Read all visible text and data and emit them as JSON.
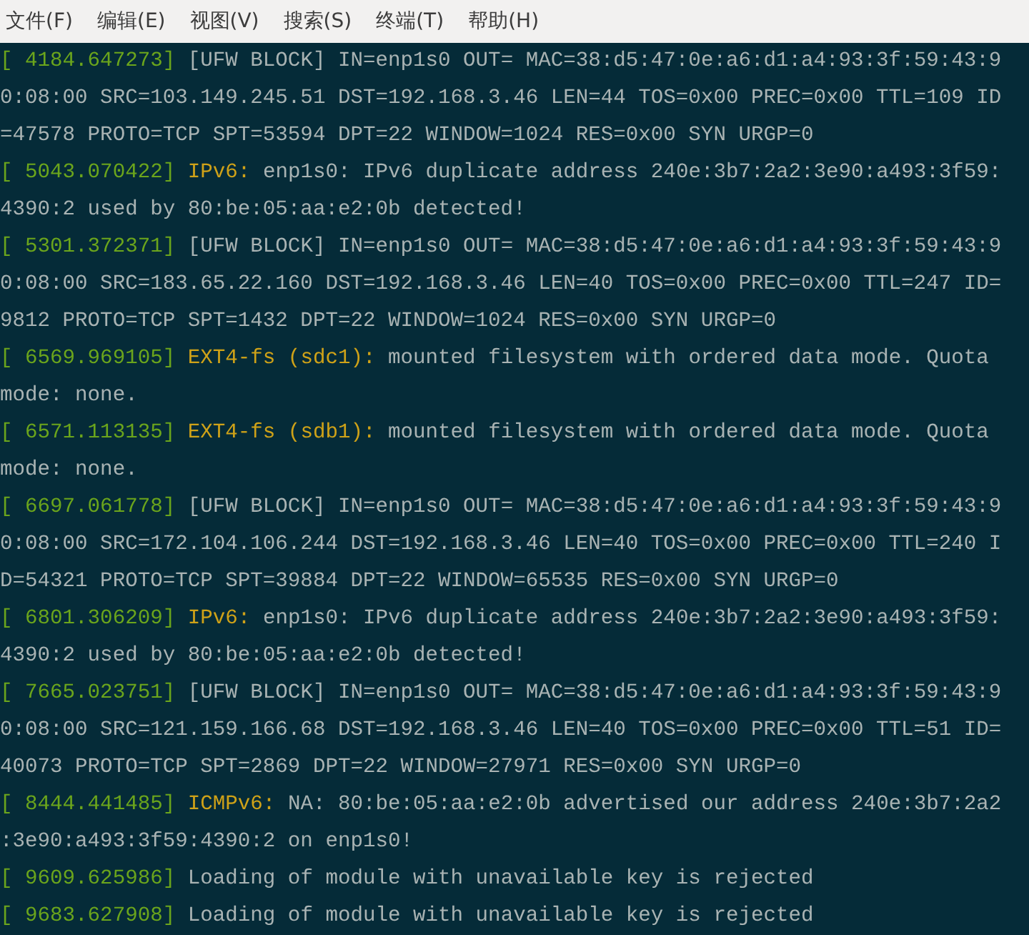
{
  "menu": [
    "文件(F)",
    "编辑(E)",
    "视图(V)",
    "搜索(S)",
    "终端(T)",
    "帮助(H)"
  ],
  "log": [
    {
      "timestamp": "[ 4184.647273]",
      "lines": [
        "[UFW BLOCK] IN=enp1s0 OUT= MAC=38:d5:47:0e:a6:d1:a4:93:3f:59:43:9",
        "0:08:00 SRC=103.149.245.51 DST=192.168.3.46 LEN=44 TOS=0x00 PREC=0x00 TTL=109 ID",
        "=47578 PROTO=TCP SPT=53594 DPT=22 WINDOW=1024 RES=0x00 SYN URGP=0"
      ]
    },
    {
      "timestamp": "[ 5043.070422]",
      "tag": "IPv6:",
      "lines": [
        "enp1s0: IPv6 duplicate address 240e:3b7:2a2:3e90:a493:3f59:",
        "4390:2 used by 80:be:05:aa:e2:0b detected!"
      ]
    },
    {
      "timestamp": "[ 5301.372371]",
      "lines": [
        "[UFW BLOCK] IN=enp1s0 OUT= MAC=38:d5:47:0e:a6:d1:a4:93:3f:59:43:9",
        "0:08:00 SRC=183.65.22.160 DST=192.168.3.46 LEN=40 TOS=0x00 PREC=0x00 TTL=247 ID=",
        "9812 PROTO=TCP SPT=1432 DPT=22 WINDOW=1024 RES=0x00 SYN URGP=0"
      ]
    },
    {
      "timestamp": "[ 6569.969105]",
      "tag": "EXT4-fs (sdc1):",
      "lines": [
        "mounted filesystem with ordered data mode. Quota",
        "mode: none."
      ]
    },
    {
      "timestamp": "[ 6571.113135]",
      "tag": "EXT4-fs (sdb1):",
      "lines": [
        "mounted filesystem with ordered data mode. Quota",
        "mode: none."
      ]
    },
    {
      "timestamp": "[ 6697.061778]",
      "lines": [
        "[UFW BLOCK] IN=enp1s0 OUT= MAC=38:d5:47:0e:a6:d1:a4:93:3f:59:43:9",
        "0:08:00 SRC=172.104.106.244 DST=192.168.3.46 LEN=40 TOS=0x00 PREC=0x00 TTL=240 I",
        "D=54321 PROTO=TCP SPT=39884 DPT=22 WINDOW=65535 RES=0x00 SYN URGP=0"
      ]
    },
    {
      "timestamp": "[ 6801.306209]",
      "tag": "IPv6:",
      "lines": [
        "enp1s0: IPv6 duplicate address 240e:3b7:2a2:3e90:a493:3f59:",
        "4390:2 used by 80:be:05:aa:e2:0b detected!"
      ]
    },
    {
      "timestamp": "[ 7665.023751]",
      "lines": [
        "[UFW BLOCK] IN=enp1s0 OUT= MAC=38:d5:47:0e:a6:d1:a4:93:3f:59:43:9",
        "0:08:00 SRC=121.159.166.68 DST=192.168.3.46 LEN=40 TOS=0x00 PREC=0x00 TTL=51 ID=",
        "40073 PROTO=TCP SPT=2869 DPT=22 WINDOW=27971 RES=0x00 SYN URGP=0"
      ]
    },
    {
      "timestamp": "[ 8444.441485]",
      "tag": "ICMPv6:",
      "lines": [
        "NA: 80:be:05:aa:e2:0b advertised our address 240e:3b7:2a2",
        ":3e90:a493:3f59:4390:2 on enp1s0!"
      ]
    },
    {
      "timestamp": "[ 9609.625986]",
      "lines": [
        "Loading of module with unavailable key is rejected"
      ]
    },
    {
      "timestamp": "[ 9683.627908]",
      "lines": [
        "Loading of module with unavailable key is rejected"
      ]
    }
  ]
}
